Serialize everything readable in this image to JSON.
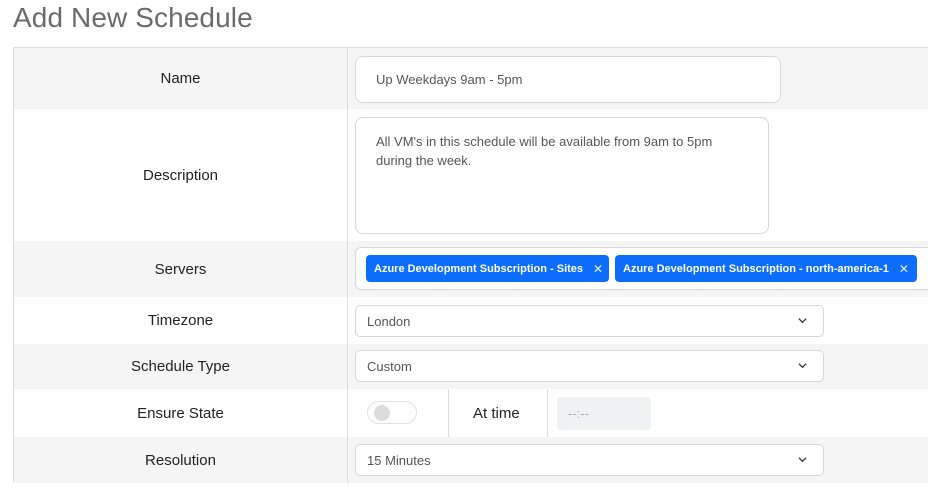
{
  "page": {
    "title": "Add New Schedule"
  },
  "form": {
    "name": {
      "label": "Name",
      "value": "Up Weekdays 9am - 5pm"
    },
    "description": {
      "label": "Description",
      "lines": [
        "All VM's in this schedule will be available from 9am to 5pm",
        "during the week."
      ]
    },
    "servers": {
      "label": "Servers",
      "chips": [
        {
          "label": "Azure Development Subscription - Sites"
        },
        {
          "label": "Azure Development Subscription - north-america-1"
        }
      ]
    },
    "timezone": {
      "label": "Timezone",
      "value": "London"
    },
    "schedule_type": {
      "label": "Schedule Type",
      "value": "Custom"
    },
    "ensure_state": {
      "label": "Ensure State",
      "toggle_on": false,
      "at_time_label": "At time",
      "time_placeholder": "--:--"
    },
    "resolution": {
      "label": "Resolution",
      "value": "15 Minutes"
    }
  },
  "colors": {
    "chip": "#0d6efd",
    "row_shaded": "#f5f5f5",
    "title": "#6b6b6b"
  },
  "icons": {
    "chip_remove": "close-icon",
    "select_arrow": "chevron-down-icon"
  }
}
